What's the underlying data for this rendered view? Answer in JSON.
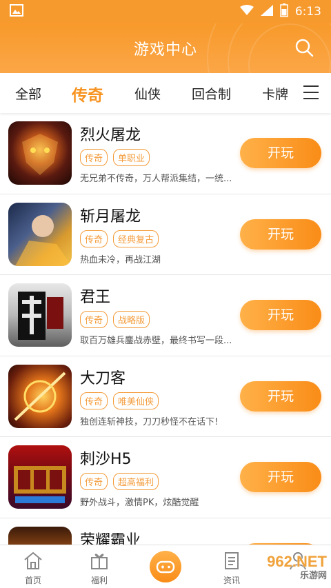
{
  "status": {
    "time": "6:13"
  },
  "header": {
    "title": "游戏中心"
  },
  "tabs": [
    {
      "label": "全部"
    },
    {
      "label": "传奇"
    },
    {
      "label": "仙侠"
    },
    {
      "label": "回合制"
    },
    {
      "label": "卡牌"
    }
  ],
  "games": [
    {
      "name": "烈火屠龙",
      "tags": [
        "传奇",
        "单职业"
      ],
      "desc": "无兄弟不传奇，万人帮派集结，一统...",
      "button": "开玩"
    },
    {
      "name": "斩月屠龙",
      "tags": [
        "传奇",
        "经典复古"
      ],
      "desc": "热血未冷，再战江湖",
      "button": "开玩"
    },
    {
      "name": "君王",
      "tags": [
        "传奇",
        "战略版"
      ],
      "desc": "取百万雄兵鏖战赤壁，最终书写一段...",
      "button": "开玩"
    },
    {
      "name": "大刀客",
      "tags": [
        "传奇",
        "唯美仙侠"
      ],
      "desc": "独创连斩神技，刀刀秒怪不在话下!",
      "button": "开玩"
    },
    {
      "name": "刺沙H5",
      "tags": [
        "传奇",
        "超高福利"
      ],
      "desc": "野外战斗，激情PK，炫酷觉醒",
      "button": "开玩"
    },
    {
      "name": "荣耀霸业",
      "tags": [],
      "desc": "",
      "button": "开玩"
    }
  ],
  "bottom_nav": [
    {
      "label": "首页"
    },
    {
      "label": "福利"
    },
    {
      "label": ""
    },
    {
      "label": "资讯"
    },
    {
      "label": ""
    }
  ],
  "watermark": {
    "main": "962.NET",
    "sub": "乐游网"
  },
  "colors": {
    "accent": "#f79320",
    "header": "#f89a2b"
  }
}
